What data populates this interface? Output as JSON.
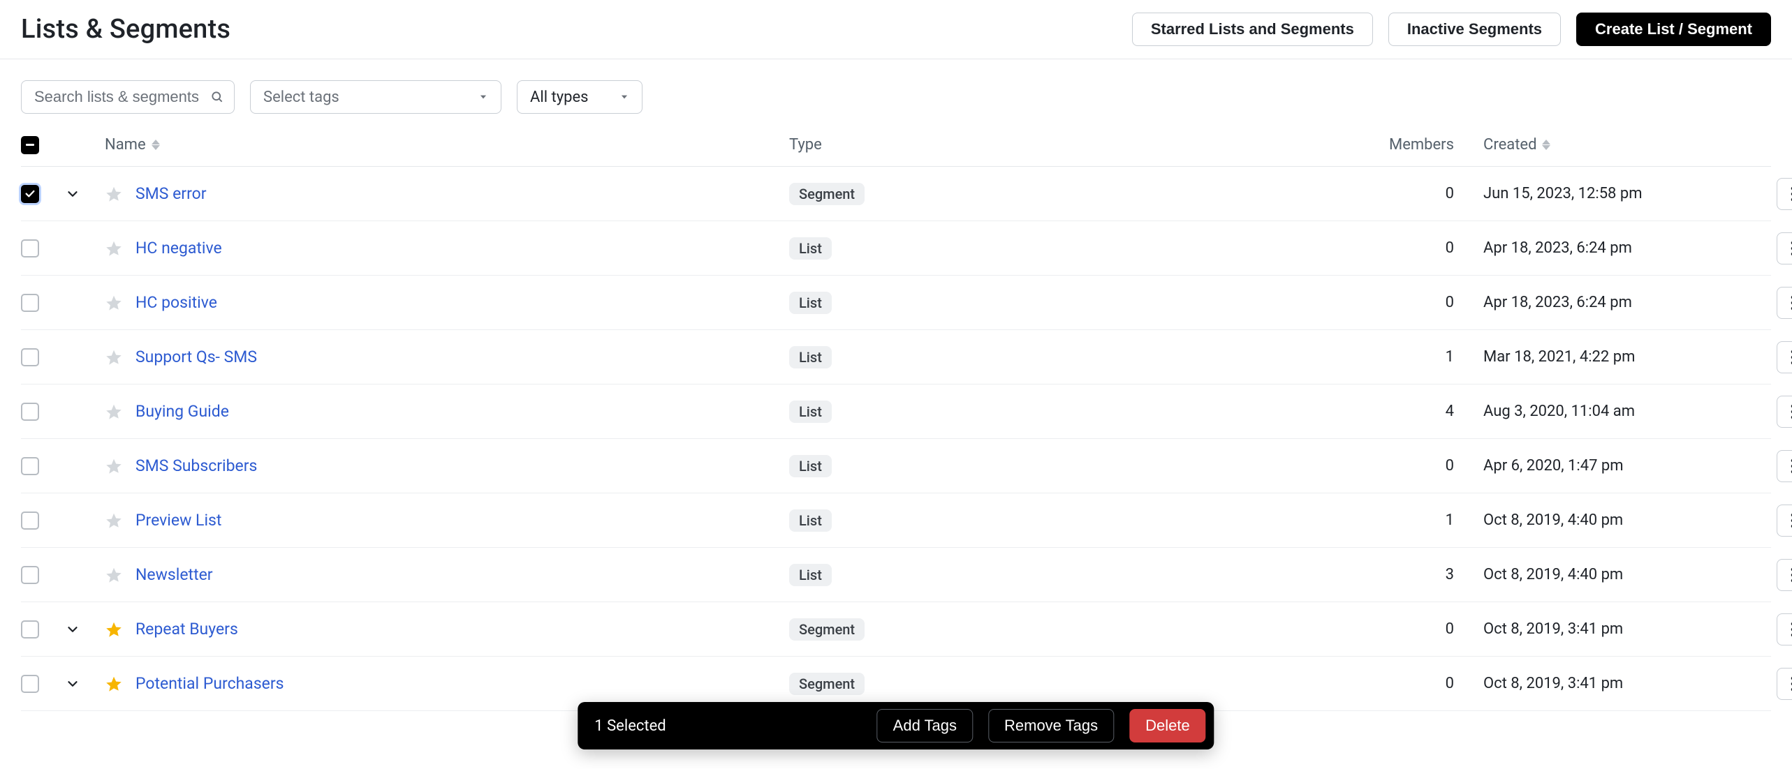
{
  "header": {
    "title": "Lists & Segments",
    "buttons": {
      "starred": "Starred Lists and Segments",
      "inactive": "Inactive Segments",
      "create": "Create List / Segment"
    }
  },
  "filters": {
    "search_placeholder": "Search lists & segments",
    "tags_placeholder": "Select tags",
    "types_label": "All types"
  },
  "columns": {
    "name": "Name",
    "type": "Type",
    "members": "Members",
    "created": "Created"
  },
  "rows": [
    {
      "name": "SMS error",
      "type": "Segment",
      "members": 0,
      "created": "Jun 15, 2023, 12:58 pm",
      "starred": false,
      "checked": true,
      "expandable": true
    },
    {
      "name": "HC negative",
      "type": "List",
      "members": 0,
      "created": "Apr 18, 2023, 6:24 pm",
      "starred": false,
      "checked": false,
      "expandable": false
    },
    {
      "name": "HC positive",
      "type": "List",
      "members": 0,
      "created": "Apr 18, 2023, 6:24 pm",
      "starred": false,
      "checked": false,
      "expandable": false
    },
    {
      "name": "Support Qs- SMS",
      "type": "List",
      "members": 1,
      "created": "Mar 18, 2021, 4:22 pm",
      "starred": false,
      "checked": false,
      "expandable": false
    },
    {
      "name": "Buying Guide",
      "type": "List",
      "members": 4,
      "created": "Aug 3, 2020, 11:04 am",
      "starred": false,
      "checked": false,
      "expandable": false
    },
    {
      "name": "SMS Subscribers",
      "type": "List",
      "members": 0,
      "created": "Apr 6, 2020, 1:47 pm",
      "starred": false,
      "checked": false,
      "expandable": false
    },
    {
      "name": "Preview List",
      "type": "List",
      "members": 1,
      "created": "Oct 8, 2019, 4:40 pm",
      "starred": false,
      "checked": false,
      "expandable": false
    },
    {
      "name": "Newsletter",
      "type": "List",
      "members": 3,
      "created": "Oct 8, 2019, 4:40 pm",
      "starred": false,
      "checked": false,
      "expandable": false
    },
    {
      "name": "Repeat Buyers",
      "type": "Segment",
      "members": 0,
      "created": "Oct 8, 2019, 3:41 pm",
      "starred": true,
      "checked": false,
      "expandable": true
    },
    {
      "name": "Potential Purchasers",
      "type": "Segment",
      "members": 0,
      "created": "Oct 8, 2019, 3:41 pm",
      "starred": true,
      "checked": false,
      "expandable": true
    }
  ],
  "selection_bar": {
    "count_label": "1 Selected",
    "add_tags": "Add Tags",
    "remove_tags": "Remove Tags",
    "delete": "Delete"
  }
}
